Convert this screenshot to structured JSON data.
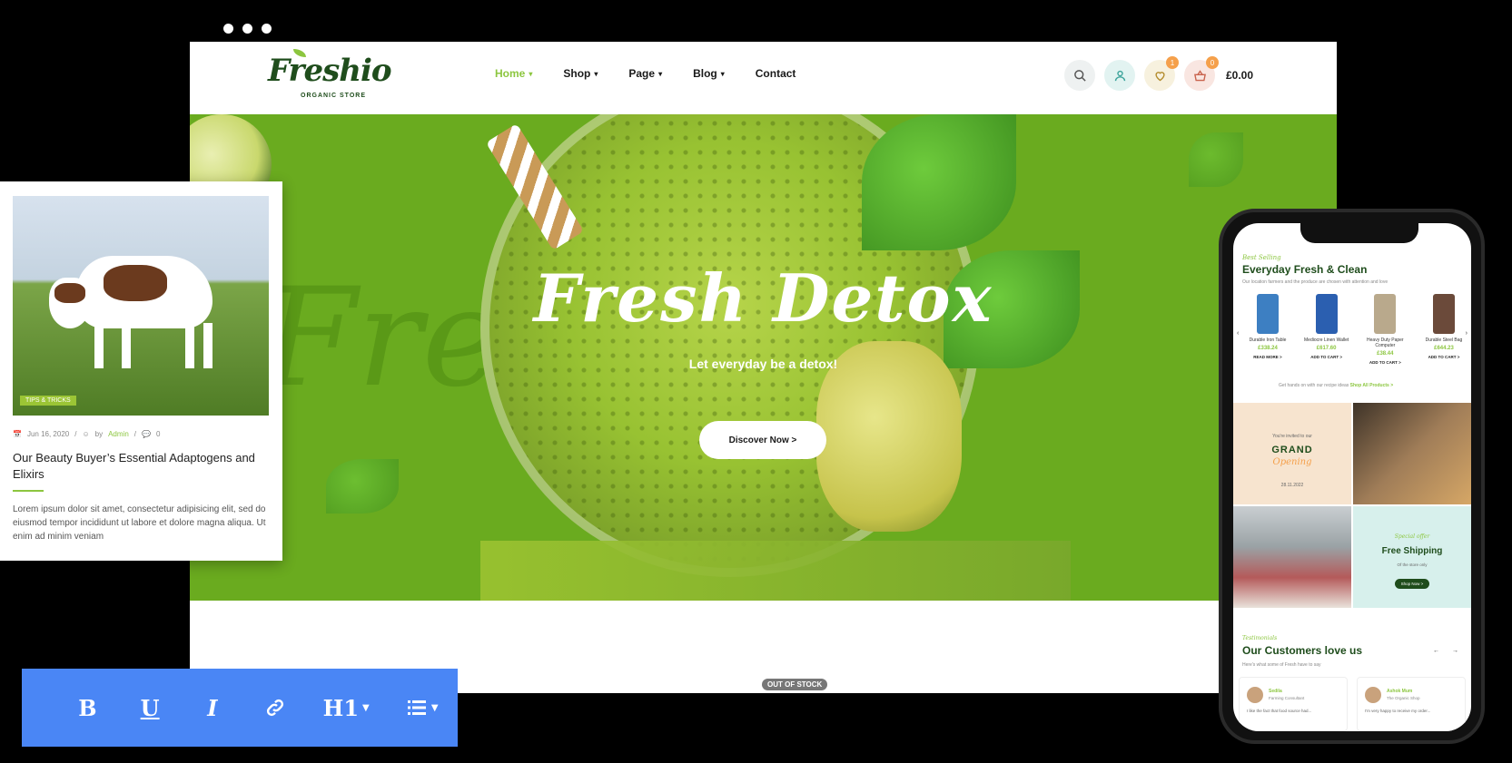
{
  "window_controls": [
    "dot",
    "dot",
    "dot"
  ],
  "header": {
    "logo": {
      "brand": "Freshio",
      "tagline": "ORGANIC STORE"
    },
    "nav": [
      {
        "label": "Home",
        "has_dropdown": true,
        "active": true
      },
      {
        "label": "Shop",
        "has_dropdown": true,
        "active": false
      },
      {
        "label": "Page",
        "has_dropdown": true,
        "active": false
      },
      {
        "label": "Blog",
        "has_dropdown": true,
        "active": false
      },
      {
        "label": "Contact",
        "has_dropdown": false,
        "active": false
      }
    ],
    "icons": {
      "search": "search-icon",
      "account": "user-icon",
      "wishlist": "heart-icon",
      "cart": "basket-icon"
    },
    "wishlist_count": "1",
    "cart_count": "0",
    "cart_total": "£0.00"
  },
  "hero": {
    "background_word": "Fresh",
    "title": "Fresh Detox",
    "subtitle": "Let everyday be a detox!",
    "button_label": "Discover Now >"
  },
  "out_of_stock_label": "OUT OF STOCK",
  "blog_card": {
    "tag": "TIPS & TRICKS",
    "date": "Jun 16, 2020",
    "by_prefix": "by",
    "author": "Admin",
    "comments": "0",
    "title": "Our Beauty Buyer’s Essential Adaptogens and Elixirs",
    "excerpt": "Lorem ipsum dolor sit amet, consectetur adipisicing elit, sed do eiusmod tempor incididunt ut labore et dolore magna aliqua. Ut enim ad minim veniam"
  },
  "toolbar": {
    "bold": "B",
    "underline": "U",
    "italic": "I",
    "link_icon": "link-icon",
    "heading": "H1",
    "list_icon": "list-icon"
  },
  "phone": {
    "best_selling_kicker": "Best Selling",
    "best_selling_title": "Everyday Fresh & Clean",
    "best_selling_desc": "Our location farmers and the produce are chosen with attention and love",
    "products": [
      {
        "name": "Durable Iron Table",
        "price": "£338.24",
        "action": "READ MORE >",
        "color": "#3d7fc2"
      },
      {
        "name": "Mediocre Linen Wallet",
        "price": "£617.60",
        "action": "ADD TO CART >",
        "color": "#2b5fb0"
      },
      {
        "name": "Heavy Duty Paper Computer",
        "price": "£38.44",
        "action": "ADD TO CART >",
        "color": "#b9a98c"
      },
      {
        "name": "Durable Steel Bag",
        "price": "£644.23",
        "action": "ADD TO CART >",
        "color": "#6b4a3a"
      }
    ],
    "note_text": "Get hands on with our recipe ideas",
    "note_link": "Shop All Products >",
    "tiles": {
      "grand_kicker": "You're invited to our",
      "grand_title": "GRAND",
      "grand_script": "Opening",
      "grand_date": "28.11.2022",
      "ship_kicker": "Special offer",
      "ship_title": "Free Shipping",
      "ship_desc": "Of the store only",
      "ship_button": "Shop Now >"
    },
    "testimonials_kicker": "Testimonials",
    "testimonials_title": "Our Customers love us",
    "testimonials_desc": "Here's what some of Fresh have to say",
    "reviews": [
      {
        "name": "Sedila",
        "role": "Farming Consultant",
        "text": "I like the fact that food source had..."
      },
      {
        "name": "Ashok Mum",
        "role": "The Organic Shop",
        "text": "I'm very happy to receive my order..."
      }
    ]
  },
  "colors": {
    "brand_green": "#8cc63f",
    "dark_green": "#1f4d1c",
    "hero_green": "#6aab1f",
    "toolbar_blue": "#4a86f5",
    "badge_orange": "#f5a04b"
  }
}
